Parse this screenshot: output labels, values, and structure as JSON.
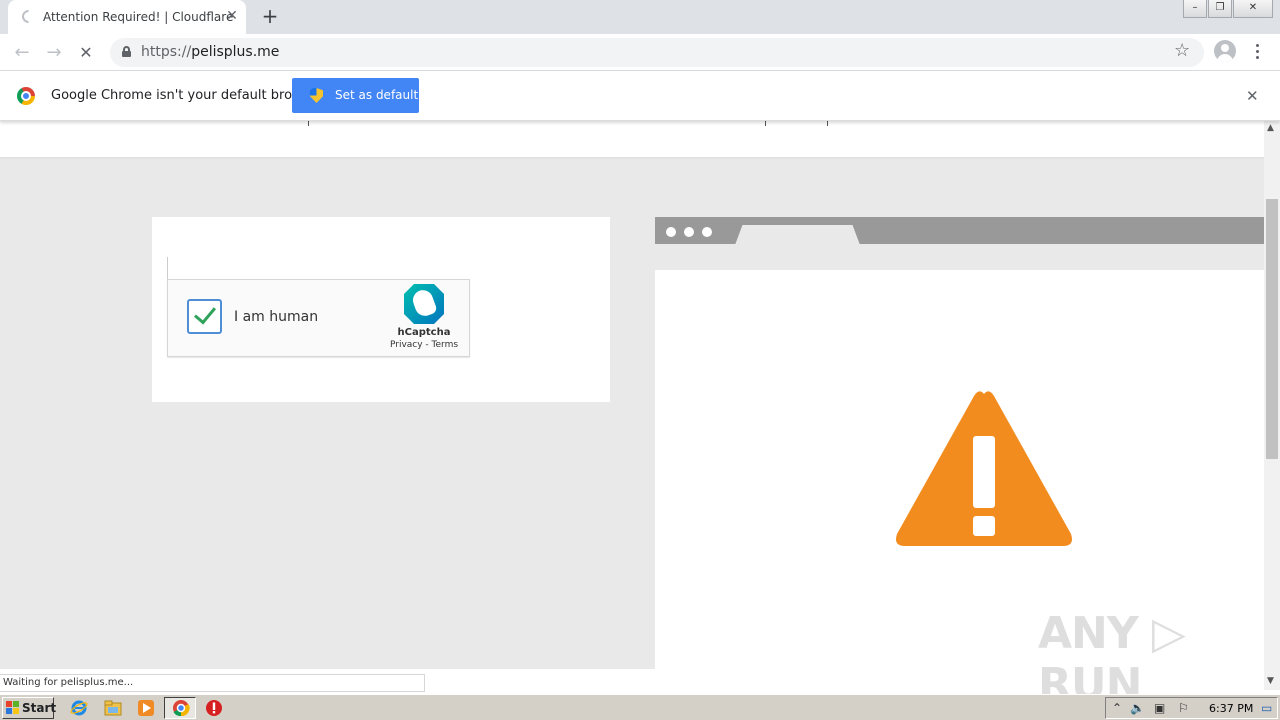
{
  "window": {
    "tab_title": "Attention Required! | Cloudflare",
    "tab_close": "✕",
    "new_tab": "+",
    "controls": {
      "minimize": "–",
      "restore": "❐",
      "close": "✕"
    }
  },
  "toolbar": {
    "back": "←",
    "forward": "→",
    "stop": "✕",
    "url_scheme": "https://",
    "url_host": "pelisplus.me",
    "bookmark": "☆"
  },
  "infobar": {
    "message": "Google Chrome isn't your default browser",
    "button_label": "Set as default",
    "close": "✕"
  },
  "captcha": {
    "checkbox_label": "I am human",
    "checked": true,
    "brand": "hCaptcha",
    "links": "Privacy - Terms"
  },
  "status_bar": {
    "text": "Waiting for pelisplus.me..."
  },
  "watermark": "ANY ▷ RUN",
  "taskbar": {
    "start_label": "Start",
    "clock": "6:37 PM"
  },
  "colors": {
    "warning": "#f28c1e",
    "primary_button": "#4285f4",
    "page_bg": "#e9e9e9",
    "check_green": "#2fa35a"
  },
  "icons": {
    "taskbar": [
      "ie-icon",
      "explorer-icon",
      "media-player-icon",
      "chrome-icon",
      "stop-sign-icon"
    ],
    "tray": [
      "tray-arrow-icon",
      "volume-icon",
      "network-icon",
      "flag-icon",
      "desktop-icon"
    ]
  }
}
